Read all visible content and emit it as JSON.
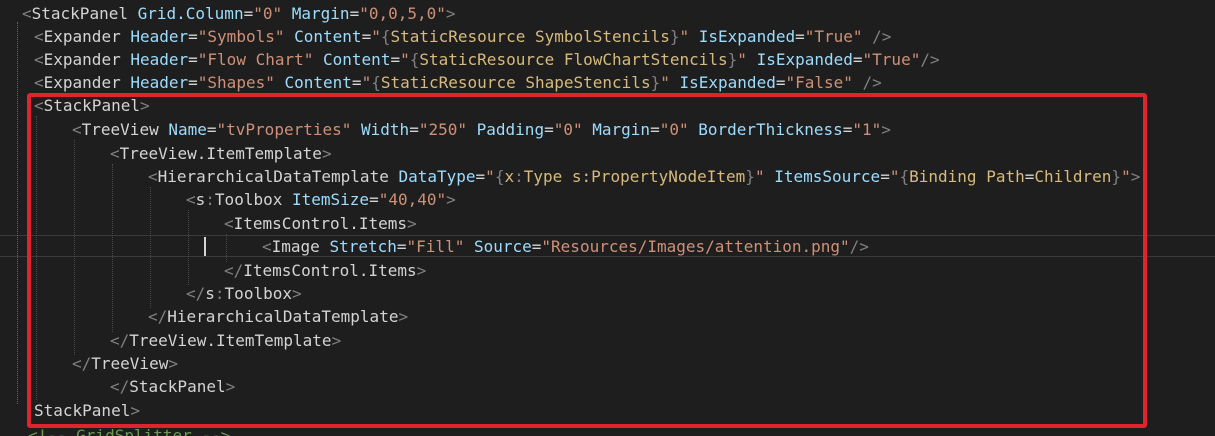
{
  "editor": {
    "language": "XAML",
    "colors": {
      "background": "#1e1e1e",
      "bracket": "#808080",
      "tag": "#d4d4d4",
      "attribute": "#9cdcfe",
      "string": "#ce9178",
      "markup_extension": "#d7ba7d",
      "highlight_box": "#e0232f"
    },
    "lines": [
      {
        "tokens": [
          {
            "t": "<",
            "c": "bracket"
          },
          {
            "t": "StackPanel",
            "c": "tag"
          },
          {
            "t": " ",
            "c": "ident"
          },
          {
            "t": "Grid.Column",
            "c": "attr"
          },
          {
            "t": "=",
            "c": "eq"
          },
          {
            "t": "\"0\"",
            "c": "str"
          },
          {
            "t": " ",
            "c": "ident"
          },
          {
            "t": "Margin",
            "c": "attr"
          },
          {
            "t": "=",
            "c": "eq"
          },
          {
            "t": "\"0,0,5,0\"",
            "c": "str"
          },
          {
            "t": ">",
            "c": "bracket"
          }
        ]
      },
      {
        "tokens": [
          {
            "t": "<",
            "c": "bracket"
          },
          {
            "t": "Expander",
            "c": "tag"
          },
          {
            "t": " ",
            "c": "ident"
          },
          {
            "t": "Header",
            "c": "attr"
          },
          {
            "t": "=",
            "c": "eq"
          },
          {
            "t": "\"Symbols\"",
            "c": "str"
          },
          {
            "t": " ",
            "c": "ident"
          },
          {
            "t": "Content",
            "c": "attr"
          },
          {
            "t": "=",
            "c": "eq"
          },
          {
            "t": "\"",
            "c": "str"
          },
          {
            "t": "{",
            "c": "bracket"
          },
          {
            "t": "StaticResource",
            "c": "ext"
          },
          {
            "t": " ",
            "c": "ident"
          },
          {
            "t": "SymbolStencils",
            "c": "ext"
          },
          {
            "t": "}",
            "c": "bracket"
          },
          {
            "t": "\"",
            "c": "str"
          },
          {
            "t": " ",
            "c": "ident"
          },
          {
            "t": "IsExpanded",
            "c": "attr"
          },
          {
            "t": "=",
            "c": "eq"
          },
          {
            "t": "\"True\"",
            "c": "str"
          },
          {
            "t": " />",
            "c": "bracket"
          }
        ]
      },
      {
        "tokens": [
          {
            "t": "<",
            "c": "bracket"
          },
          {
            "t": "Expander",
            "c": "tag"
          },
          {
            "t": " ",
            "c": "ident"
          },
          {
            "t": "Header",
            "c": "attr"
          },
          {
            "t": "=",
            "c": "eq"
          },
          {
            "t": "\"Flow Chart\"",
            "c": "str"
          },
          {
            "t": " ",
            "c": "ident"
          },
          {
            "t": "Content",
            "c": "attr"
          },
          {
            "t": "=",
            "c": "eq"
          },
          {
            "t": "\"",
            "c": "str"
          },
          {
            "t": "{",
            "c": "bracket"
          },
          {
            "t": "StaticResource",
            "c": "ext"
          },
          {
            "t": " ",
            "c": "ident"
          },
          {
            "t": "FlowChartStencils",
            "c": "ext"
          },
          {
            "t": "}",
            "c": "bracket"
          },
          {
            "t": "\"",
            "c": "str"
          },
          {
            "t": " ",
            "c": "ident"
          },
          {
            "t": "IsExpanded",
            "c": "attr"
          },
          {
            "t": "=",
            "c": "eq"
          },
          {
            "t": "\"True\"",
            "c": "str"
          },
          {
            "t": "/>",
            "c": "bracket"
          }
        ]
      },
      {
        "tokens": [
          {
            "t": "<",
            "c": "bracket"
          },
          {
            "t": "Expander",
            "c": "tag"
          },
          {
            "t": " ",
            "c": "ident"
          },
          {
            "t": "Header",
            "c": "attr"
          },
          {
            "t": "=",
            "c": "eq"
          },
          {
            "t": "\"Shapes\"",
            "c": "str"
          },
          {
            "t": " ",
            "c": "ident"
          },
          {
            "t": "Content",
            "c": "attr"
          },
          {
            "t": "=",
            "c": "eq"
          },
          {
            "t": "\"",
            "c": "str"
          },
          {
            "t": "{",
            "c": "bracket"
          },
          {
            "t": "StaticResource",
            "c": "ext"
          },
          {
            "t": " ",
            "c": "ident"
          },
          {
            "t": "ShapeStencils",
            "c": "ext"
          },
          {
            "t": "}",
            "c": "bracket"
          },
          {
            "t": "\"",
            "c": "str"
          },
          {
            "t": " ",
            "c": "ident"
          },
          {
            "t": "IsExpanded",
            "c": "attr"
          },
          {
            "t": "=",
            "c": "eq"
          },
          {
            "t": "\"False\"",
            "c": "str"
          },
          {
            "t": " />",
            "c": "bracket"
          }
        ]
      },
      {
        "tokens": [
          {
            "t": "<",
            "c": "bracket"
          },
          {
            "t": "StackPanel",
            "c": "tag"
          },
          {
            "t": ">",
            "c": "bracket"
          }
        ]
      },
      {
        "tokens": [
          {
            "t": "<",
            "c": "bracket"
          },
          {
            "t": "TreeView",
            "c": "tag"
          },
          {
            "t": " ",
            "c": "ident"
          },
          {
            "t": "Name",
            "c": "attr"
          },
          {
            "t": "=",
            "c": "eq"
          },
          {
            "t": "\"tvProperties\"",
            "c": "str"
          },
          {
            "t": " ",
            "c": "ident"
          },
          {
            "t": "Width",
            "c": "attr"
          },
          {
            "t": "=",
            "c": "eq"
          },
          {
            "t": "\"250\"",
            "c": "str"
          },
          {
            "t": " ",
            "c": "ident"
          },
          {
            "t": "Padding",
            "c": "attr"
          },
          {
            "t": "=",
            "c": "eq"
          },
          {
            "t": "\"0\"",
            "c": "str"
          },
          {
            "t": " ",
            "c": "ident"
          },
          {
            "t": "Margin",
            "c": "attr"
          },
          {
            "t": "=",
            "c": "eq"
          },
          {
            "t": "\"0\"",
            "c": "str"
          },
          {
            "t": " ",
            "c": "ident"
          },
          {
            "t": "BorderThickness",
            "c": "attr"
          },
          {
            "t": "=",
            "c": "eq"
          },
          {
            "t": "\"1\"",
            "c": "str"
          },
          {
            "t": ">",
            "c": "bracket"
          }
        ]
      },
      {
        "tokens": [
          {
            "t": "<",
            "c": "bracket"
          },
          {
            "t": "TreeView.ItemTemplate",
            "c": "tag"
          },
          {
            "t": ">",
            "c": "bracket"
          }
        ]
      },
      {
        "tokens": [
          {
            "t": "<",
            "c": "bracket"
          },
          {
            "t": "HierarchicalDataTemplate",
            "c": "tag"
          },
          {
            "t": " ",
            "c": "ident"
          },
          {
            "t": "DataType",
            "c": "attr"
          },
          {
            "t": "=",
            "c": "eq"
          },
          {
            "t": "\"",
            "c": "str"
          },
          {
            "t": "{",
            "c": "bracket"
          },
          {
            "t": "x",
            "c": "ext"
          },
          {
            "t": ":",
            "c": "bracket"
          },
          {
            "t": "Type",
            "c": "ext"
          },
          {
            "t": " ",
            "c": "ident"
          },
          {
            "t": "s:PropertyNodeItem",
            "c": "ext"
          },
          {
            "t": "}",
            "c": "bracket"
          },
          {
            "t": "\"",
            "c": "str"
          },
          {
            "t": " ",
            "c": "ident"
          },
          {
            "t": "ItemsSource",
            "c": "attr"
          },
          {
            "t": "=",
            "c": "eq"
          },
          {
            "t": "\"",
            "c": "str"
          },
          {
            "t": "{",
            "c": "bracket"
          },
          {
            "t": "Binding",
            "c": "ext"
          },
          {
            "t": " ",
            "c": "ident"
          },
          {
            "t": "Path",
            "c": "ext"
          },
          {
            "t": "=",
            "c": "eq"
          },
          {
            "t": "Children",
            "c": "ext"
          },
          {
            "t": "}",
            "c": "bracket"
          },
          {
            "t": "\"",
            "c": "str"
          },
          {
            "t": ">",
            "c": "bracket"
          }
        ]
      },
      {
        "tokens": [
          {
            "t": "<",
            "c": "bracket"
          },
          {
            "t": "s",
            "c": "tag"
          },
          {
            "t": ":",
            "c": "bracket"
          },
          {
            "t": "Toolbox",
            "c": "tag"
          },
          {
            "t": " ",
            "c": "ident"
          },
          {
            "t": "ItemSize",
            "c": "attr"
          },
          {
            "t": "=",
            "c": "eq"
          },
          {
            "t": "\"40,40\"",
            "c": "str"
          },
          {
            "t": ">",
            "c": "bracket"
          }
        ]
      },
      {
        "tokens": [
          {
            "t": "<",
            "c": "bracket"
          },
          {
            "t": "ItemsControl.Items",
            "c": "tag"
          },
          {
            "t": ">",
            "c": "bracket"
          }
        ]
      },
      {
        "tokens": [
          {
            "t": "<",
            "c": "bracket"
          },
          {
            "t": "Image",
            "c": "tag"
          },
          {
            "t": " ",
            "c": "ident"
          },
          {
            "t": "Stretch",
            "c": "attr"
          },
          {
            "t": "=",
            "c": "eq"
          },
          {
            "t": "\"Fill\"",
            "c": "str"
          },
          {
            "t": " ",
            "c": "ident"
          },
          {
            "t": "Source",
            "c": "attr"
          },
          {
            "t": "=",
            "c": "eq"
          },
          {
            "t": "\"Resources/Images/attention.png\"",
            "c": "str"
          },
          {
            "t": "/>",
            "c": "bracket"
          }
        ]
      },
      {
        "tokens": [
          {
            "t": "</",
            "c": "bracket"
          },
          {
            "t": "ItemsControl.Items",
            "c": "tag"
          },
          {
            "t": ">",
            "c": "bracket"
          }
        ]
      },
      {
        "tokens": [
          {
            "t": "</",
            "c": "bracket"
          },
          {
            "t": "s",
            "c": "tag"
          },
          {
            "t": ":",
            "c": "bracket"
          },
          {
            "t": "Toolbox",
            "c": "tag"
          },
          {
            "t": ">",
            "c": "bracket"
          }
        ]
      },
      {
        "tokens": [
          {
            "t": "</",
            "c": "bracket"
          },
          {
            "t": "HierarchicalDataTemplate",
            "c": "tag"
          },
          {
            "t": ">",
            "c": "bracket"
          }
        ]
      },
      {
        "tokens": [
          {
            "t": "</",
            "c": "bracket"
          },
          {
            "t": "TreeView.ItemTemplate",
            "c": "tag"
          },
          {
            "t": ">",
            "c": "bracket"
          }
        ]
      },
      {
        "tokens": [
          {
            "t": "</",
            "c": "bracket"
          },
          {
            "t": "TreeView",
            "c": "tag"
          },
          {
            "t": ">",
            "c": "bracket"
          }
        ]
      },
      {
        "tokens": [
          {
            "t": "</",
            "c": "bracket"
          },
          {
            "t": "StackPanel",
            "c": "tag"
          },
          {
            "t": ">",
            "c": "bracket"
          }
        ]
      },
      {
        "tokens": [
          {
            "t": "StackPanel",
            "c": "tag"
          },
          {
            "t": ">",
            "c": "bracket"
          }
        ]
      }
    ],
    "cut_off_line": "<!-- GridSplitter -->"
  }
}
